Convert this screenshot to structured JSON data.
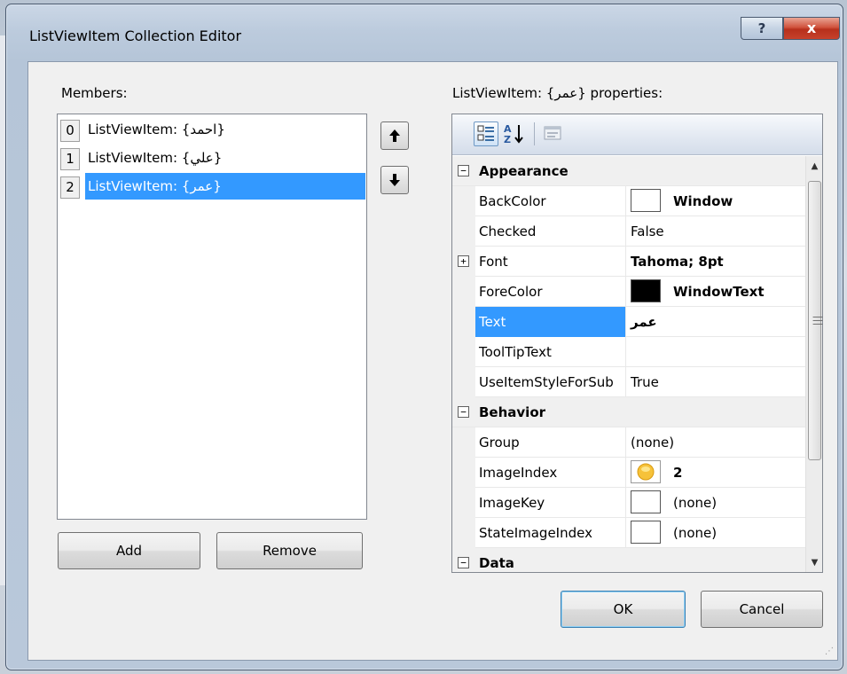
{
  "window": {
    "title": "ListViewItem Collection Editor",
    "help_glyph": "?",
    "close_glyph": "x"
  },
  "members": {
    "label": "Members:",
    "items": [
      {
        "index": "0",
        "text": "ListViewItem: {احمد}"
      },
      {
        "index": "1",
        "text": "ListViewItem: {علي}"
      },
      {
        "index": "2",
        "text": "ListViewItem: {عمر}"
      }
    ],
    "selected_index": 2,
    "move_up_glyph": "🡅",
    "move_down_glyph": "🡇",
    "add_label": "Add",
    "remove_label": "Remove"
  },
  "properties": {
    "label": "ListViewItem: {عمر} properties:",
    "toolbar_icons": [
      "categorized-icon",
      "alphabetical-icon",
      "property-pages-icon"
    ],
    "rows": [
      {
        "kind": "category",
        "name": "Appearance",
        "expander": "−"
      },
      {
        "kind": "prop",
        "name": "BackColor",
        "value": "Window",
        "bold": true,
        "swatch": "#ffffff"
      },
      {
        "kind": "prop",
        "name": "Checked",
        "value": "False",
        "bold": false
      },
      {
        "kind": "prop",
        "name": "Font",
        "value": "Tahoma; 8pt",
        "bold": true,
        "expander": "+"
      },
      {
        "kind": "prop",
        "name": "ForeColor",
        "value": "WindowText",
        "bold": true,
        "swatch": "#000000"
      },
      {
        "kind": "prop",
        "name": "Text",
        "value": "عمر",
        "bold": true,
        "selected": true
      },
      {
        "kind": "prop",
        "name": "ToolTipText",
        "value": "",
        "bold": false
      },
      {
        "kind": "prop",
        "name": "UseItemStyleForSub",
        "value": "True",
        "bold": false
      },
      {
        "kind": "category",
        "name": "Behavior",
        "expander": "−"
      },
      {
        "kind": "prop",
        "name": "Group",
        "value": "(none)",
        "bold": false
      },
      {
        "kind": "prop",
        "name": "ImageIndex",
        "value": "2",
        "bold": true,
        "image": true
      },
      {
        "kind": "prop",
        "name": "ImageKey",
        "value": "(none)",
        "bold": false,
        "swatch": "#ffffff"
      },
      {
        "kind": "prop",
        "name": "StateImageIndex",
        "value": "(none)",
        "bold": false,
        "swatch": "#ffffff"
      },
      {
        "kind": "category",
        "name": "Data",
        "expander": "−"
      }
    ]
  },
  "footer": {
    "ok_label": "OK",
    "cancel_label": "Cancel"
  },
  "colors": {
    "selection": "#3399ff",
    "close_button": "#c6412b"
  }
}
